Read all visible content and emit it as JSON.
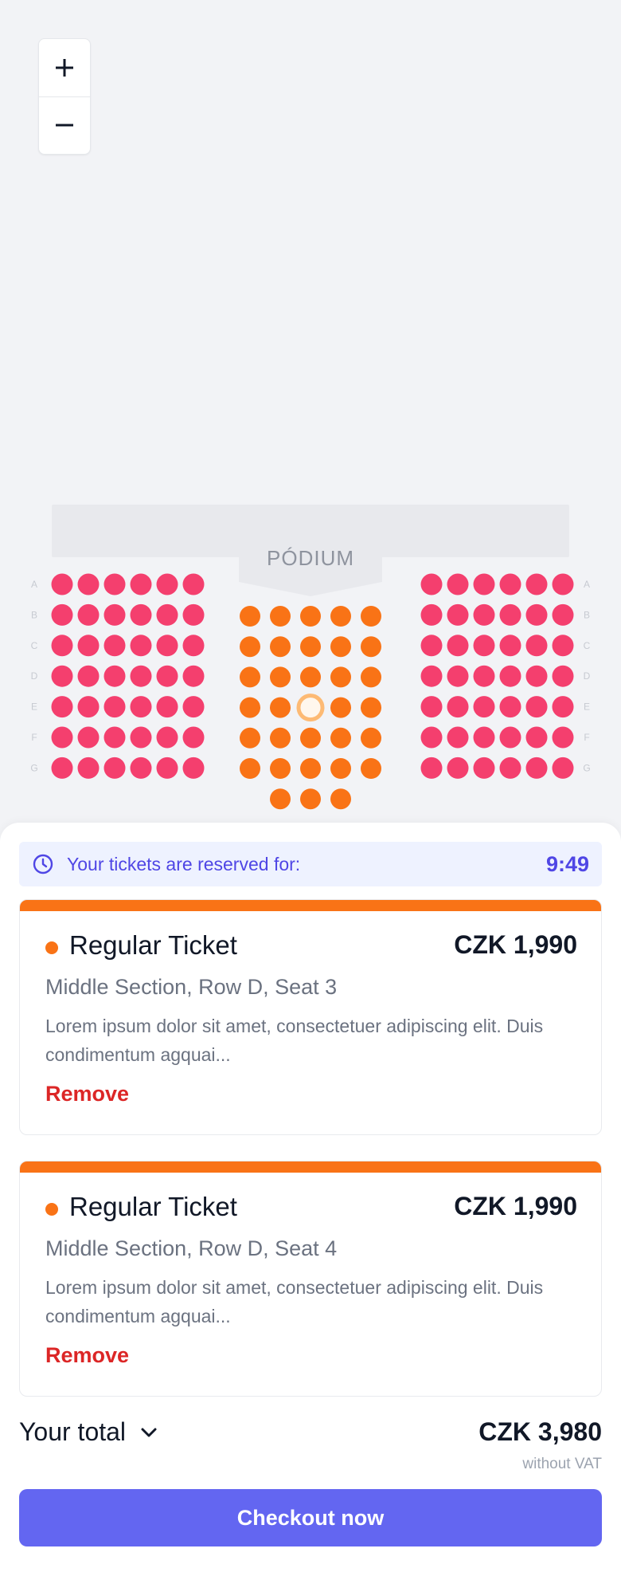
{
  "zoom": {
    "in_icon": "plus-icon",
    "out_icon": "minus-icon"
  },
  "seatmap": {
    "stage_label": "PÓDIUM",
    "row_labels": [
      "A",
      "B",
      "C",
      "D",
      "E",
      "F",
      "G"
    ],
    "colors": {
      "side_section": "#f43f6e",
      "middle_section": "#f97316",
      "selected_ring": "#fdba74",
      "selected_fill": "#fff7ed",
      "stage": "#e8e9ed"
    },
    "side_seats_per_row": 6,
    "middle_rows": [
      {
        "row": "A",
        "seats": 5
      },
      {
        "row": "B",
        "seats": 5
      },
      {
        "row": "C",
        "seats": 5
      },
      {
        "row": "D",
        "seats": 5,
        "selected_seats": [
          3
        ]
      },
      {
        "row": "E",
        "seats": 5
      },
      {
        "row": "F",
        "seats": 5
      },
      {
        "row": "G",
        "seats": 3
      }
    ]
  },
  "reservation": {
    "message": "Your tickets are reserved for:",
    "time": "9:49",
    "icon": "clock-icon"
  },
  "tickets": [
    {
      "name": "Regular Ticket",
      "price": "CZK 1,990",
      "location": "Middle Section, Row D, Seat 3",
      "description": "Lorem ipsum dolor sit amet, consectetuer adipiscing elit. Duis condimentum agquai...",
      "remove_label": "Remove"
    },
    {
      "name": "Regular Ticket",
      "price": "CZK 1,990",
      "location": "Middle Section, Row D, Seat 4",
      "description": "Lorem ipsum dolor sit amet, consectetuer adipiscing elit. Duis condimentum agquai...",
      "remove_label": "Remove"
    }
  ],
  "summary": {
    "total_label": "Your total",
    "total_value": "CZK 3,980",
    "vat_note": "without VAT",
    "expand_icon": "chevron-down-icon"
  },
  "checkout_label": "Checkout now"
}
